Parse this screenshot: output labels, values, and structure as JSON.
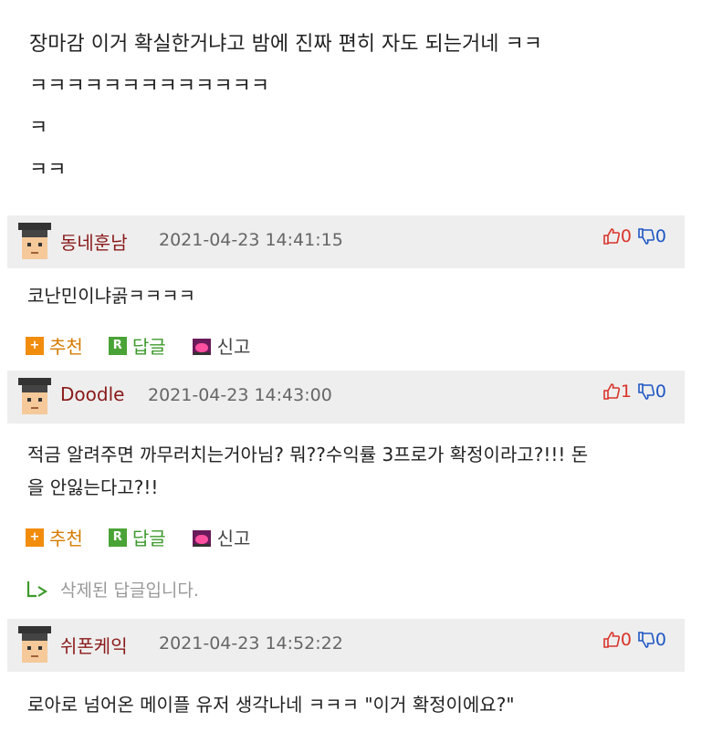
{
  "post": {
    "lines": [
      "장마감 이거 확실한거냐고 밤에 진짜 편히 자도 되는거네 ㅋㅋ",
      "ㅋㅋㅋㅋㅋㅋㅋㅋㅋㅋㅋㅋㅋ",
      "ㅋ",
      "ㅋㅋ"
    ]
  },
  "actions": {
    "recommend": "추천",
    "reply": "답글",
    "report": "신고",
    "reply_icon": "R",
    "plus_icon": "+"
  },
  "comments": [
    {
      "author": "동네훈남",
      "date": "2021-04-23 14:41:15",
      "up": "0",
      "down": "0",
      "body": [
        "코난민이냐곩ㅋㅋㅋㅋ"
      ]
    },
    {
      "author": "Doodle",
      "date": "2021-04-23 14:43:00",
      "up": "1",
      "down": "0",
      "body": [
        "적금 알려주면 까무러치는거아님? 뭐??수익률 3프로가 확정이라고?!!! 돈",
        "을 안잃는다고?!!"
      ]
    },
    {
      "author": "쉬폰케익",
      "date": "2021-04-23 14:52:22",
      "up": "0",
      "down": "0",
      "body": [
        "로아로 넘어온 메이플 유저 생각나네 ㅋㅋㅋ \"이거 확정이에요?\""
      ]
    }
  ],
  "deleted_reply": "삭제된 답글입니다.",
  "colors": {
    "author": "#8a1a1a",
    "up": "#d9342b",
    "down": "#1f57c3",
    "recommend": "#f28c0d",
    "reply": "#4aa336"
  }
}
